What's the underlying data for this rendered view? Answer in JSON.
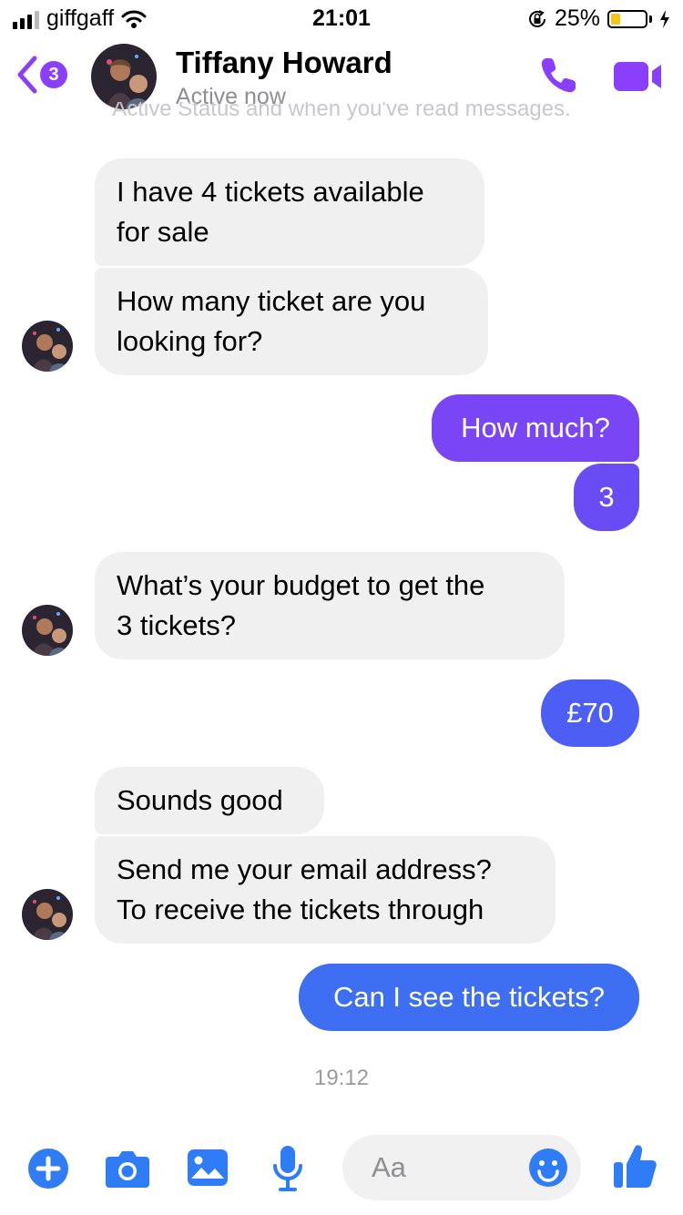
{
  "status_bar": {
    "carrier": "giffgaff",
    "time": "21:01",
    "battery_percent": "25%",
    "battery_level": 0.25,
    "icons": [
      "signal-icon",
      "wifi-icon",
      "rotation-lock-icon",
      "battery-icon",
      "charging-bolt-icon"
    ]
  },
  "header": {
    "back_badge": "3",
    "contact_name": "Tiffany Howard",
    "status": "Active now",
    "icons": [
      "back-chevron-icon",
      "phone-icon",
      "video-camera-icon"
    ]
  },
  "ghost_banner": "Active Status and when you've read messages.",
  "messages": [
    {
      "from": "them",
      "text_lines": [
        "I have 4 tickets available",
        "for sale"
      ]
    },
    {
      "from": "them",
      "text_lines": [
        "How many ticket are you",
        "looking for?"
      ]
    },
    {
      "from": "me",
      "text": "How much?"
    },
    {
      "from": "me",
      "text": "3"
    },
    {
      "from": "them",
      "text_lines": [
        "What’s your budget to get the",
        "3 tickets?"
      ]
    },
    {
      "from": "me",
      "text": "£70"
    },
    {
      "from": "them",
      "text": "Sounds good"
    },
    {
      "from": "them",
      "text_lines": [
        "Send me your email address?",
        "To receive the tickets through"
      ]
    },
    {
      "from": "me",
      "text": "Can I see the tickets?"
    }
  ],
  "timestamp": "19:12",
  "composer": {
    "placeholder": "Aa",
    "icons": [
      "plus-icon",
      "camera-icon",
      "image-icon",
      "microphone-icon",
      "emoji-icon",
      "thumbs-up-icon"
    ]
  },
  "colors": {
    "accent_purple": "#8a3ffc",
    "outgoing_purple": "#7a45f5",
    "outgoing_blue": "#3e6ff2",
    "incoming_bg": "#f0f0f0",
    "composer_blue": "#2e7cf6"
  }
}
